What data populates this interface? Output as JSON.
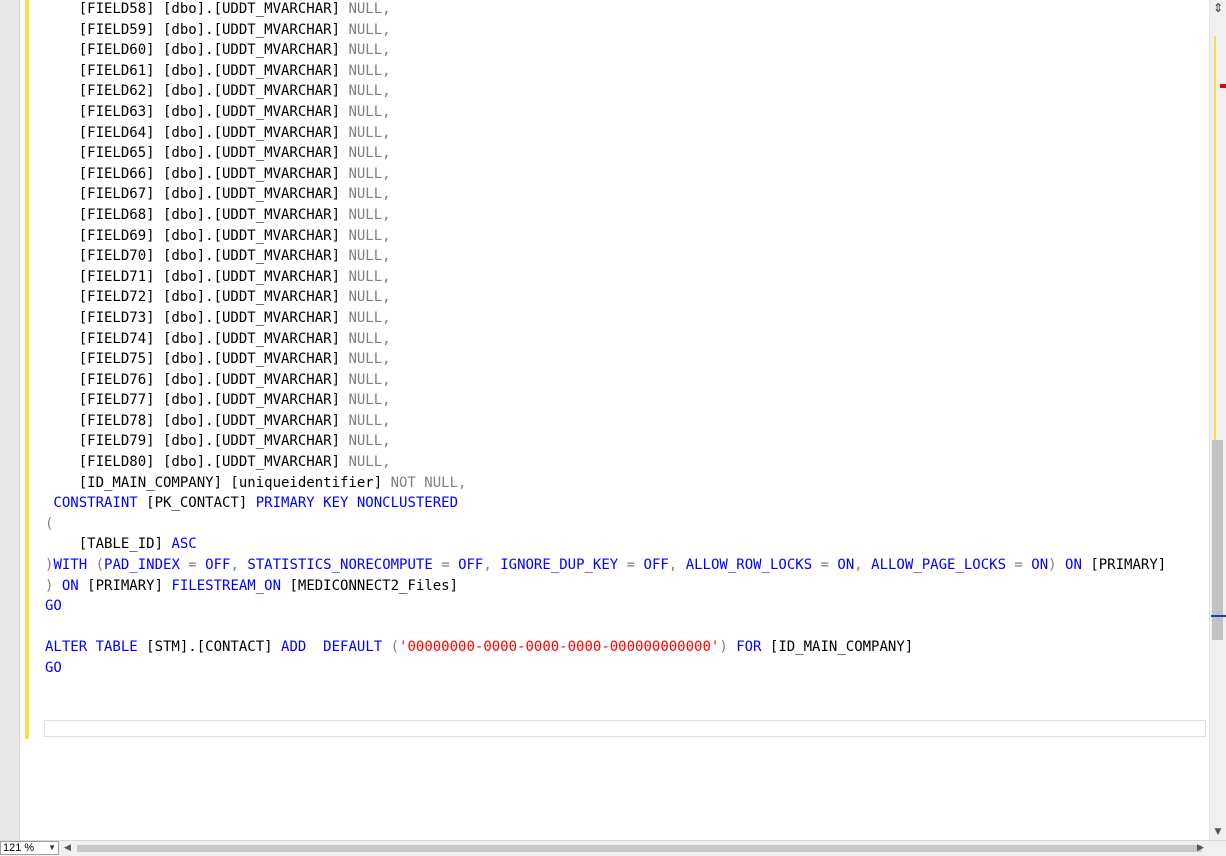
{
  "editor": {
    "field_lines": [
      {
        "field": "    [FIELD58] [dbo].[UDDT_MVARCHAR] ",
        "null": "NULL,"
      },
      {
        "field": "    [FIELD59] [dbo].[UDDT_MVARCHAR] ",
        "null": "NULL,"
      },
      {
        "field": "    [FIELD60] [dbo].[UDDT_MVARCHAR] ",
        "null": "NULL,"
      },
      {
        "field": "    [FIELD61] [dbo].[UDDT_MVARCHAR] ",
        "null": "NULL,"
      },
      {
        "field": "    [FIELD62] [dbo].[UDDT_MVARCHAR] ",
        "null": "NULL,"
      },
      {
        "field": "    [FIELD63] [dbo].[UDDT_MVARCHAR] ",
        "null": "NULL,"
      },
      {
        "field": "    [FIELD64] [dbo].[UDDT_MVARCHAR] ",
        "null": "NULL,"
      },
      {
        "field": "    [FIELD65] [dbo].[UDDT_MVARCHAR] ",
        "null": "NULL,"
      },
      {
        "field": "    [FIELD66] [dbo].[UDDT_MVARCHAR] ",
        "null": "NULL,"
      },
      {
        "field": "    [FIELD67] [dbo].[UDDT_MVARCHAR] ",
        "null": "NULL,"
      },
      {
        "field": "    [FIELD68] [dbo].[UDDT_MVARCHAR] ",
        "null": "NULL,"
      },
      {
        "field": "    [FIELD69] [dbo].[UDDT_MVARCHAR] ",
        "null": "NULL,"
      },
      {
        "field": "    [FIELD70] [dbo].[UDDT_MVARCHAR] ",
        "null": "NULL,"
      },
      {
        "field": "    [FIELD71] [dbo].[UDDT_MVARCHAR] ",
        "null": "NULL,"
      },
      {
        "field": "    [FIELD72] [dbo].[UDDT_MVARCHAR] ",
        "null": "NULL,"
      },
      {
        "field": "    [FIELD73] [dbo].[UDDT_MVARCHAR] ",
        "null": "NULL,"
      },
      {
        "field": "    [FIELD74] [dbo].[UDDT_MVARCHAR] ",
        "null": "NULL,"
      },
      {
        "field": "    [FIELD75] [dbo].[UDDT_MVARCHAR] ",
        "null": "NULL,"
      },
      {
        "field": "    [FIELD76] [dbo].[UDDT_MVARCHAR] ",
        "null": "NULL,"
      },
      {
        "field": "    [FIELD77] [dbo].[UDDT_MVARCHAR] ",
        "null": "NULL,"
      },
      {
        "field": "    [FIELD78] [dbo].[UDDT_MVARCHAR] ",
        "null": "NULL,"
      },
      {
        "field": "    [FIELD79] [dbo].[UDDT_MVARCHAR] ",
        "null": "NULL,"
      },
      {
        "field": "    [FIELD80] [dbo].[UDDT_MVARCHAR] ",
        "null": "NULL,"
      }
    ],
    "id_line": {
      "field": "    [ID_MAIN_COMPANY] [uniqueidentifier] ",
      "null": "NOT NULL,"
    },
    "constraint_line": {
      "kw1": " CONSTRAINT",
      "name": " [PK_CONTACT] ",
      "kw2": "PRIMARY KEY NONCLUSTERED"
    },
    "open_paren": "(",
    "table_id_line": {
      "field": "    [TABLE_ID] ",
      "kw": "ASC"
    },
    "with_line": {
      "close": ")",
      "with": "WITH",
      "open": " (",
      "opts": [
        {
          "kw": "PAD_INDEX",
          "eq": " = ",
          "val": "OFF",
          "sep": ", "
        },
        {
          "kw": "STATISTICS_NORECOMPUTE",
          "eq": " = ",
          "val": "OFF",
          "sep": ", "
        },
        {
          "kw": "IGNORE_DUP_KEY",
          "eq": " = ",
          "val": "OFF",
          "sep": ", "
        },
        {
          "kw": "ALLOW_ROW_LOCKS",
          "eq": " = ",
          "val": "ON",
          "sep": ", "
        },
        {
          "kw": "ALLOW_PAGE_LOCKS",
          "eq": " = ",
          "val": "ON",
          "sep": ")"
        }
      ],
      "on": " ON",
      "target": " [PRIMARY]"
    },
    "on_line": {
      "close": ")",
      "on": " ON",
      "primary": " [PRIMARY] ",
      "fs": "FILESTREAM_ON",
      "files": " [MEDICONNECT2_Files]"
    },
    "go1": "GO",
    "alter_line": {
      "alter": "ALTER TABLE",
      "tbl": " [STM].[CONTACT] ",
      "add": "ADD",
      "default": "  DEFAULT",
      "paren_open": " (",
      "guid": "'00000000-0000-0000-0000-000000000000'",
      "paren_close": ")",
      "for": " FOR",
      "col": " [ID_MAIN_COMPANY]"
    },
    "go2": "GO"
  },
  "status_bar": {
    "zoom": "121 %"
  },
  "colors": {
    "keyword": "#0000ff",
    "gray": "#808080",
    "string": "#ff0000",
    "change_bar": "#f7e04b"
  }
}
